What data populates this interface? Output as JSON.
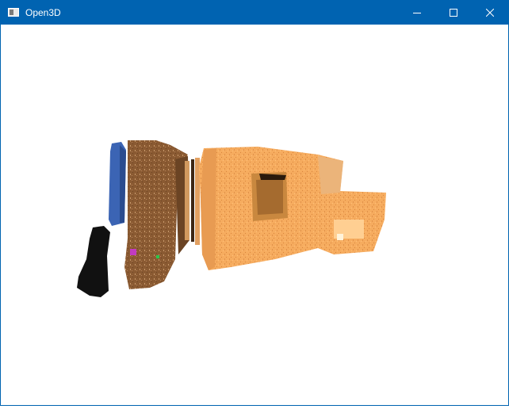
{
  "window": {
    "title": "Open3D",
    "titlebar_color": "#0063b1",
    "controls": {
      "minimize_icon": "minimize-icon",
      "maximize_icon": "maximize-icon",
      "close_icon": "close-icon"
    }
  },
  "viewport": {
    "background": "#ffffff",
    "content": "3d-point-cloud-render",
    "point_colors": [
      "#3b64b4",
      "#8a5a32",
      "#f5a85a",
      "#000000"
    ]
  }
}
